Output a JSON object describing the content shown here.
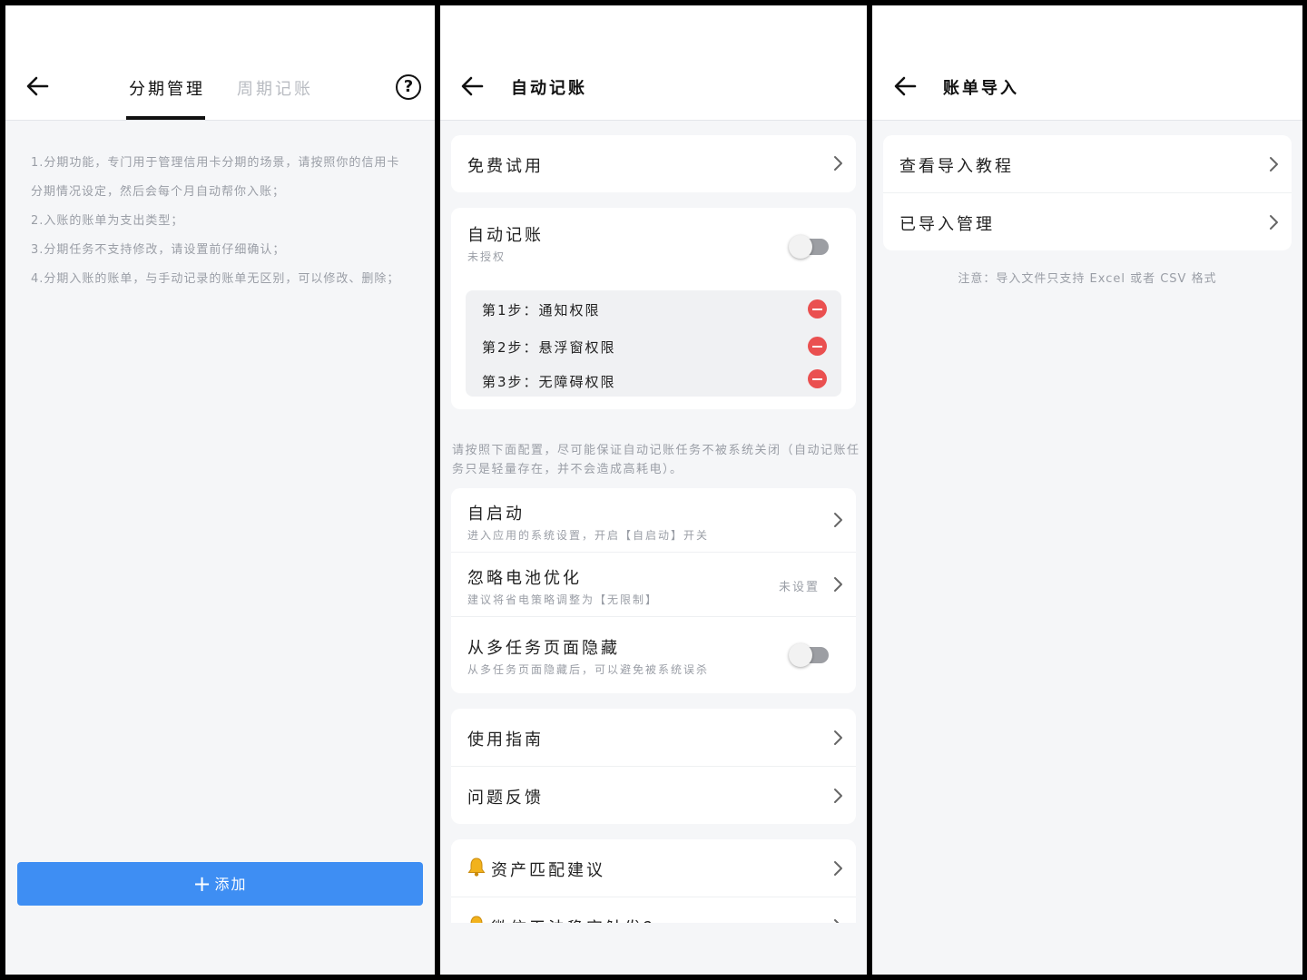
{
  "installment": {
    "tabs": [
      {
        "label": "分期管理",
        "active": true
      },
      {
        "label": "周期记账",
        "active": false
      }
    ],
    "help_glyph": "?",
    "info_lines": [
      "1.分期功能，专门用于管理信用卡分期的场景，请按照你的信用卡分期情况设定，然后会每个月自动帮你入账；",
      "2.入账的账单为支出类型；",
      "3.分期任务不支持修改，请设置前仔细确认；",
      "4.分期入账的账单，与手动记录的账单无区别，可以修改、删除；"
    ],
    "add_button": {
      "icon": "plus-icon",
      "label": "添加"
    }
  },
  "auto_record": {
    "title": "自动记账",
    "trial": {
      "label": "免费试用"
    },
    "auto": {
      "title": "自动记账",
      "status": "未授权",
      "enabled": false,
      "steps": [
        {
          "label": "第1步：通知权限",
          "status_icon": "minus-circle-icon"
        },
        {
          "label": "第2步：悬浮窗权限",
          "status_icon": "minus-circle-icon"
        },
        {
          "label": "第3步：无障碍权限",
          "status_icon": "minus-circle-icon"
        }
      ]
    },
    "note": "请按照下面配置，尽可能保证自动记账任务不被系统关闭（自动记账任务只是轻量存在，并不会造成高耗电）。",
    "settings": [
      {
        "title": "自启动",
        "subtitle": "进入应用的系统设置，开启【自启动】开关",
        "status": ""
      },
      {
        "title": "忽略电池优化",
        "subtitle": "建议将省电策略调整为【无限制】",
        "status": "未设置"
      },
      {
        "title": "从多任务页面隐藏",
        "subtitle": "从多任务页面隐藏后，可以避免被系统误杀",
        "toggle": false
      }
    ],
    "help_links": [
      {
        "label": "使用指南"
      },
      {
        "label": "问题反馈"
      }
    ],
    "tips": [
      {
        "icon": "bell-icon",
        "label": "资产匹配建议"
      },
      {
        "icon": "bell-icon",
        "label": "微信无法稳定触发？"
      }
    ]
  },
  "bill_import": {
    "title": "账单导入",
    "items": [
      {
        "label": "查看导入教程"
      },
      {
        "label": "已导入管理"
      }
    ],
    "note": "注意：导入文件只支持 Excel 或者 CSV 格式"
  },
  "colors": {
    "accent": "#3e8ef3",
    "danger": "#ea5050",
    "muted_text": "#9a9ea6",
    "page_bg": "#f5f6f8"
  }
}
